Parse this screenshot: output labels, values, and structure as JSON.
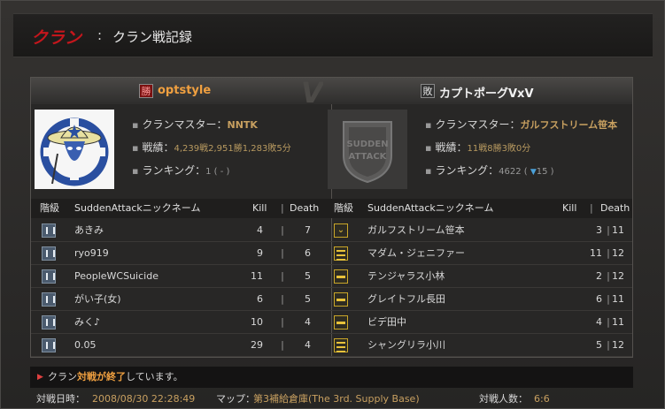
{
  "header": {
    "title": "クラン",
    "separator": ":",
    "subtitle": "クラン戦記録"
  },
  "vs_label": "VS",
  "teams": {
    "left": {
      "result": "勝",
      "name": "optstyle",
      "master_label": "クランマスター：",
      "master": "NNTK",
      "record_label": "戦績：",
      "record": "4,239戦2,951勝1,283敗5分",
      "ranking_label": "ランキング：",
      "ranking": "1 ( - )",
      "columns": {
        "rank": "階級",
        "name": "SuddenAttackニックネーム",
        "kill": "Kill",
        "sep": "|",
        "death": "Death"
      },
      "players": [
        {
          "rank_icon": "rank-silver-icon",
          "name": "あきみ",
          "kill": "4",
          "death": "7"
        },
        {
          "rank_icon": "rank-silver-icon",
          "name": "ryo919",
          "kill": "9",
          "death": "6"
        },
        {
          "rank_icon": "rank-silver-icon",
          "name": "PeopleWCSuicide",
          "kill": "11",
          "death": "5"
        },
        {
          "rank_icon": "rank-silver-icon",
          "name": "がい子(女)",
          "kill": "6",
          "death": "5"
        },
        {
          "rank_icon": "rank-silver-icon",
          "name": "みく♪",
          "kill": "10",
          "death": "4"
        },
        {
          "rank_icon": "rank-silver-icon",
          "name": "0.05",
          "kill": "29",
          "death": "4"
        }
      ]
    },
    "right": {
      "result": "敗",
      "name": "カプトポーグVxV",
      "master_label": "クランマスター：",
      "master": "ガルフストリーム笹本",
      "record_label": "戦績：",
      "record": "11戦8勝3敗0分",
      "ranking_label": "ランキング：",
      "ranking": "4622",
      "ranking_change": "15",
      "columns": {
        "rank": "階級",
        "name": "SuddenAttackニックネーム",
        "kill": "Kill",
        "sep": "|",
        "death": "Death"
      },
      "players": [
        {
          "rank_icon": "rank-chevron-icon",
          "name": "ガルフストリーム笹本",
          "kill": "3",
          "death": "11"
        },
        {
          "rank_icon": "rank-triple-bar-icon",
          "name": "マダム・ジェニファー",
          "kill": "11",
          "death": "12"
        },
        {
          "rank_icon": "rank-single-bar-icon",
          "name": "テンジャラス小林",
          "kill": "2",
          "death": "12"
        },
        {
          "rank_icon": "rank-single-bar-icon",
          "name": "グレイトフル長田",
          "kill": "6",
          "death": "11"
        },
        {
          "rank_icon": "rank-single-bar-icon",
          "name": "ビデ田中",
          "kill": "4",
          "death": "11"
        },
        {
          "rank_icon": "rank-double-bar-icon",
          "name": "シャングリラ小川",
          "kill": "5",
          "death": "12"
        }
      ]
    }
  },
  "status": {
    "prefix": "クラン",
    "highlight": "対戦が終了",
    "suffix": "しています。"
  },
  "footer": {
    "datetime_label": "対戦日時：",
    "datetime": "2008/08/30 22:28:49",
    "map_label": "マップ：",
    "map": "第3補給倉庫(The 3rd. Supply Base)",
    "players_label": "対戦人数：",
    "players": "6:6"
  },
  "colors": {
    "title_red": "#c4161c",
    "winner_orange": "#f0a040",
    "value_gold": "#c8a060"
  }
}
